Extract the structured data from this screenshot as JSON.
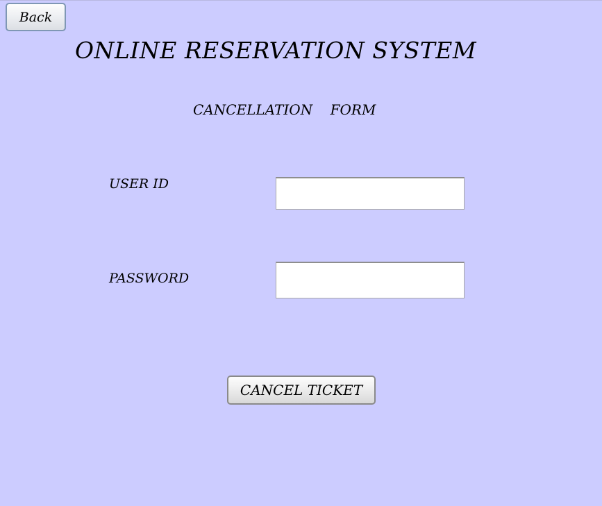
{
  "header": {
    "back_label": "Back",
    "title": "ONLINE RESERVATION SYSTEM",
    "subtitle": "CANCELLATION    FORM"
  },
  "form": {
    "user_id_label": "USER ID",
    "user_id_value": "",
    "password_label": "PASSWORD",
    "password_value": "",
    "submit_label": "CANCEL TICKET"
  },
  "colors": {
    "background": "#ccccff",
    "field_background": "#ffffff"
  }
}
